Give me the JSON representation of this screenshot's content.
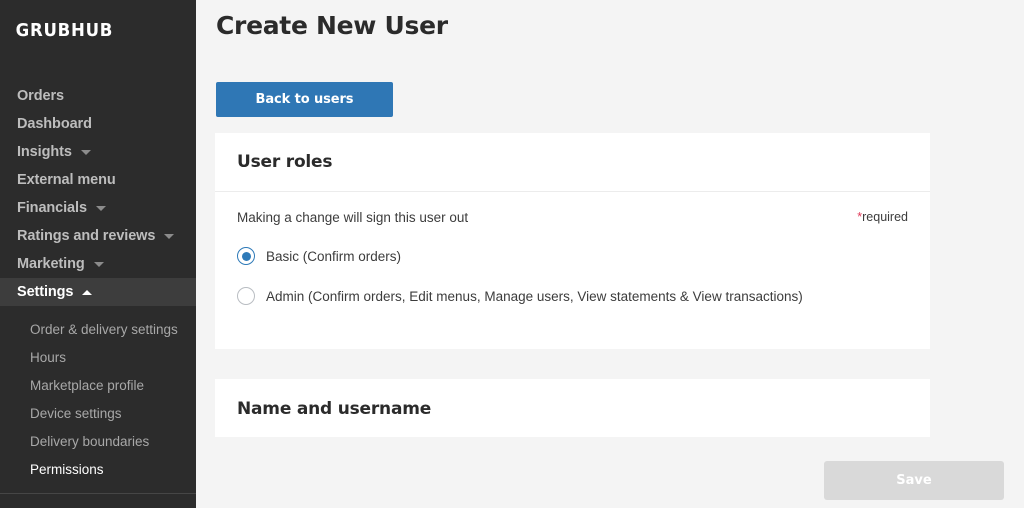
{
  "sidebar": {
    "logo": "GRUBHUB",
    "main_items": [
      {
        "label": "Orders",
        "has_caret": false,
        "active": false
      },
      {
        "label": "Dashboard",
        "has_caret": false,
        "active": false
      },
      {
        "label": "Insights",
        "has_caret": true,
        "caret": "chevron-down",
        "active": false
      },
      {
        "label": "External menu",
        "has_caret": false,
        "active": false
      },
      {
        "label": "Financials",
        "has_caret": true,
        "caret": "chevron-down",
        "active": false
      },
      {
        "label": "Ratings and reviews",
        "has_caret": true,
        "caret": "chevron-down",
        "active": false
      },
      {
        "label": "Marketing",
        "has_caret": true,
        "caret": "chevron-down",
        "active": false
      },
      {
        "label": "Settings",
        "has_caret": true,
        "caret": "chevron-up",
        "active": true
      }
    ],
    "sub_items": [
      {
        "label": "Order & delivery settings",
        "active": false
      },
      {
        "label": "Hours",
        "active": false
      },
      {
        "label": "Marketplace profile",
        "active": false
      },
      {
        "label": "Device settings",
        "active": false
      },
      {
        "label": "Delivery boundaries",
        "active": false
      },
      {
        "label": "Permissions",
        "active": true
      }
    ]
  },
  "main": {
    "page_title": "Create New User",
    "back_button_label": "Back to users",
    "cards": {
      "user_roles": {
        "title": "User roles",
        "note": "Making a change will sign this user out",
        "required_star": "*",
        "required_text": "required",
        "options": [
          {
            "label": "Basic (Confirm orders)",
            "selected": true
          },
          {
            "label": "Admin (Confirm orders, Edit menus, Manage users, View statements & View transactions)",
            "selected": false
          }
        ]
      },
      "name_and_username": {
        "title": "Name and username"
      }
    }
  },
  "footer": {
    "save_label": "Save",
    "save_disabled": true
  },
  "colors": {
    "sidebar_bg": "#2c2c2c",
    "sidebar_active_bg": "#3d3d3d",
    "accent_blue": "#2f77b5",
    "radio_blue": "#2e7ab8",
    "required_red": "#e03757",
    "page_bg": "#f4f4f4",
    "card_bg": "#ffffff",
    "save_disabled_bg": "#d9d9d9"
  }
}
